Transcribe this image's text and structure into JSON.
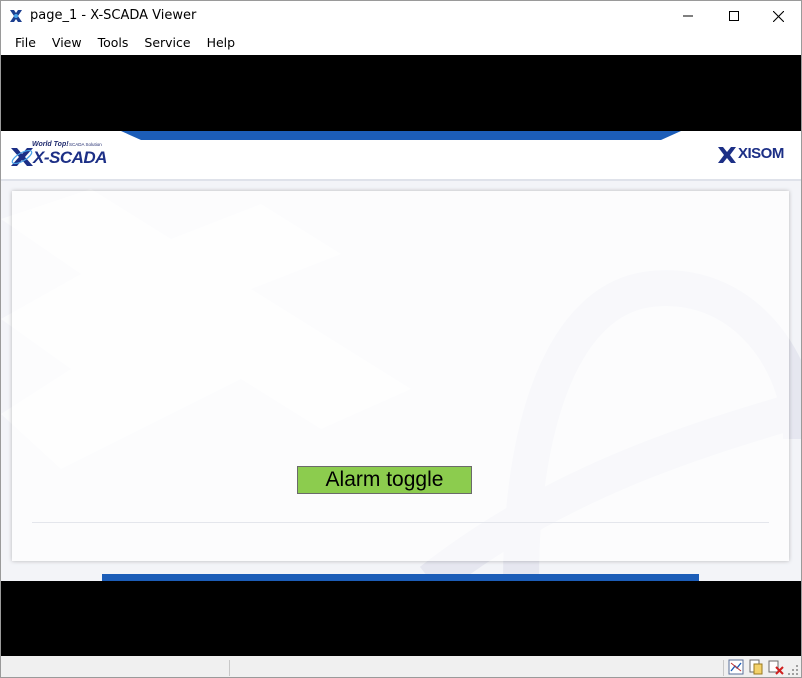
{
  "window": {
    "title": "page_1 - X-SCADA Viewer",
    "controls": {
      "minimize": "minimize",
      "maximize": "maximize",
      "close": "close"
    }
  },
  "menu": {
    "items": [
      {
        "label": "File"
      },
      {
        "label": "View"
      },
      {
        "label": "Tools"
      },
      {
        "label": "Service"
      },
      {
        "label": "Help"
      }
    ]
  },
  "header": {
    "logo_left": {
      "tagline": "World Top!",
      "subtitle": "SCADA Solution",
      "name": "X-SCADA"
    },
    "logo_right": {
      "name": "XISOM"
    }
  },
  "main": {
    "alarm_button_label": "Alarm toggle"
  },
  "colors": {
    "accent_blue": "#1c5db8",
    "brand_navy": "#1c2f86",
    "alarm_button": "#8ccc4e",
    "frame_black": "#000000"
  },
  "statusbar": {
    "icons": [
      "network-status-icon",
      "page-document-icon",
      "disconnect-icon"
    ]
  }
}
